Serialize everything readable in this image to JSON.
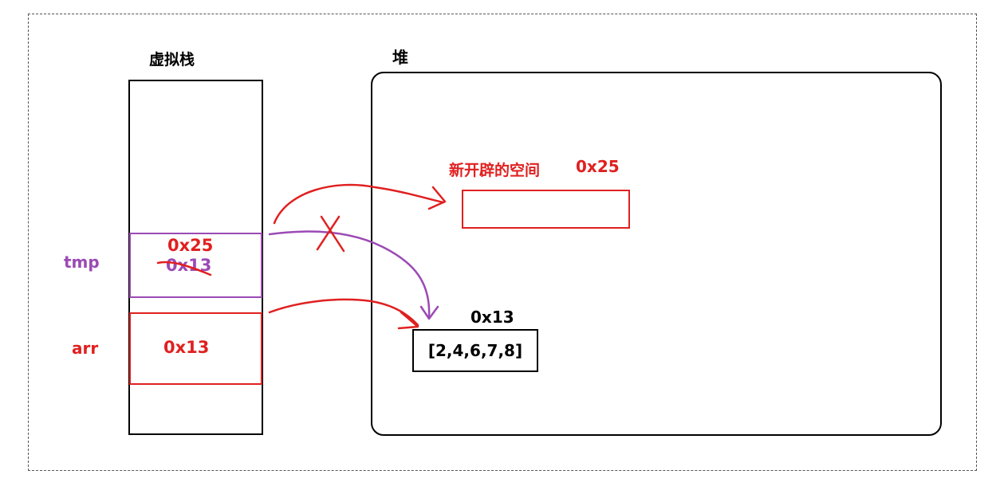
{
  "stack": {
    "title": "虚拟栈",
    "tmp": {
      "name": "tmp",
      "new_value": "0x25",
      "old_value": "0x13"
    },
    "arr": {
      "name": "arr",
      "value": "0x13"
    }
  },
  "heap": {
    "title": "堆",
    "new_space": {
      "label": "新开辟的空间",
      "address": "0x25"
    },
    "array": {
      "address": "0x13",
      "content": "[2,4,6,7,8]"
    }
  },
  "colors": {
    "red": "#e02020",
    "purple": "#9b4ab4",
    "black": "#000000"
  }
}
